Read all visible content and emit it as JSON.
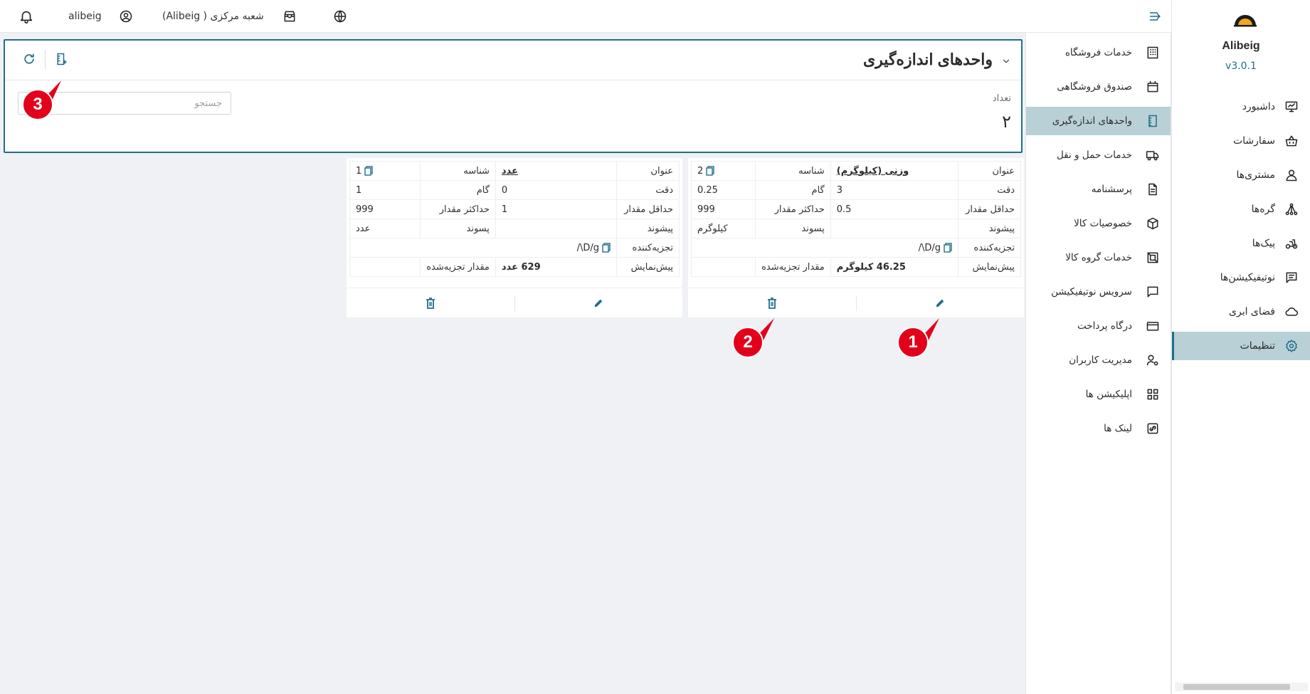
{
  "topbar": {
    "username": "alibeig",
    "branch": "شعبه مرکزی ( Alibeig)"
  },
  "app": {
    "name": "Alibeig",
    "version": "v3.0.1"
  },
  "sidebar": {
    "items": [
      {
        "label": "داشبورد",
        "icon": "monitor-icon"
      },
      {
        "label": "سفارشات",
        "icon": "basket-icon"
      },
      {
        "label": "مشتری‌ها",
        "icon": "user-icon"
      },
      {
        "label": "گره‌ها",
        "icon": "nodes-icon"
      },
      {
        "label": "پیک‌ها",
        "icon": "scooter-icon"
      },
      {
        "label": "نوتیفیکیشن‌ها",
        "icon": "message-icon"
      },
      {
        "label": "فضای ابری",
        "icon": "cloud-icon"
      },
      {
        "label": "تنظیمات",
        "icon": "gear-icon",
        "active": true
      }
    ]
  },
  "submenu": {
    "items": [
      {
        "label": "خدمات فروشگاه",
        "icon": "building-icon"
      },
      {
        "label": "صندوق فروشگاهی",
        "icon": "register-icon"
      },
      {
        "label": "واحدهای اندازه‌گیری",
        "icon": "ruler-icon",
        "active": true
      },
      {
        "label": "خدمات حمل و نقل",
        "icon": "truck-icon"
      },
      {
        "label": "پرسشنامه",
        "icon": "document-icon"
      },
      {
        "label": "خصوصیات کالا",
        "icon": "box-icon"
      },
      {
        "label": "خدمات گروه کالا",
        "icon": "group-icon"
      },
      {
        "label": "سرویس نوتیفیکیشن",
        "icon": "chat-icon"
      },
      {
        "label": "درگاه پرداخت",
        "icon": "card-icon"
      },
      {
        "label": "مدیریت کاربران",
        "icon": "user-gear-icon"
      },
      {
        "label": "اپلیکیشن ها",
        "icon": "apps-icon"
      },
      {
        "label": "لینک ها",
        "icon": "link-icon"
      }
    ]
  },
  "panel": {
    "title": "واحدهای اندازه‌گیری",
    "search_placeholder": "جستجو",
    "count_label": "تعداد",
    "count_value": "۲"
  },
  "labels": {
    "title": "عنوان",
    "id": "شناسه",
    "precision": "دقت",
    "step": "گام",
    "min": "حداقل مقدار",
    "max": "حداکثر مقدار",
    "prefix": "پیشوند",
    "suffix": "پسوند",
    "parser": "تجزیه‌کننده",
    "preview": "پیش‌نمایش",
    "parsed": "مقدار تجزیه‌شده"
  },
  "units": [
    {
      "title": "وزنی (کیلوگرم)",
      "id": "2",
      "precision": "3",
      "step": "0.25",
      "min": "0.5",
      "max": "999",
      "prefix": "",
      "suffix": "کیلوگرم",
      "parser": "/\\D/g",
      "preview": "46.25 کیلوگرم",
      "parsed": ""
    },
    {
      "title": "عدد",
      "id": "1",
      "precision": "0",
      "step": "1",
      "min": "1",
      "max": "999",
      "prefix": "",
      "suffix": "عدد",
      "parser": "/\\D/g",
      "preview": "629 عدد",
      "parsed": ""
    }
  ],
  "annotations": [
    "1",
    "2",
    "3"
  ],
  "colors": {
    "accent": "#1f6f8b",
    "active_bg": "#b9d0d6",
    "badge": "#e3001b",
    "page_bg": "#eff1f4"
  }
}
